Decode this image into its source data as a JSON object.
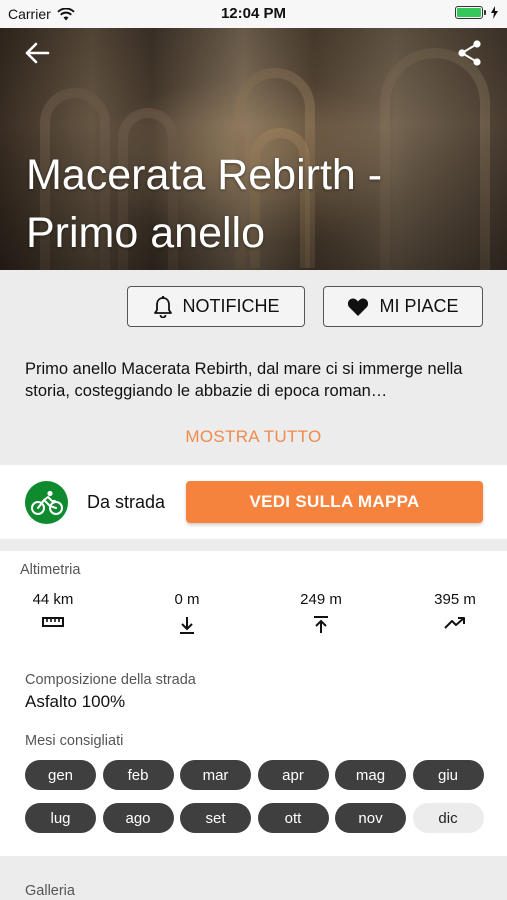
{
  "status_bar": {
    "carrier": "Carrier",
    "time": "12:04 PM",
    "battery_level": 1.0,
    "battery_color": "#35c759"
  },
  "hero": {
    "title": "Macerata Rebirth - Primo anello",
    "back_icon": "back-arrow-icon",
    "share_icon": "share-icon"
  },
  "actions": {
    "notify_label": "NOTIFICHE",
    "like_label": "MI PIACE"
  },
  "description": {
    "text": "Primo anello Macerata Rebirth, dal mare ci si immerge nella storia, costeggiando le abbazie di epoca roman…",
    "show_all": "MOSTRA TUTTO"
  },
  "route": {
    "type_icon": "road-bike-icon",
    "type_label": "Da strada",
    "map_button": "VEDI SULLA MAPPA",
    "accent_color": "#f5833d",
    "type_color": "#0f8a2e"
  },
  "altimetry": {
    "label": "Altimetria",
    "distance": "44 km",
    "min_altitude": "0 m",
    "max_altitude": "249 m",
    "elevation_gain": "395 m"
  },
  "road": {
    "label": "Composizione della strada",
    "value": "Asfalto 100%"
  },
  "months": {
    "label": "Mesi consigliati",
    "items": [
      {
        "label": "gen",
        "recommended": true
      },
      {
        "label": "feb",
        "recommended": true
      },
      {
        "label": "mar",
        "recommended": true
      },
      {
        "label": "apr",
        "recommended": true
      },
      {
        "label": "mag",
        "recommended": true
      },
      {
        "label": "giu",
        "recommended": true
      },
      {
        "label": "lug",
        "recommended": true
      },
      {
        "label": "ago",
        "recommended": true
      },
      {
        "label": "set",
        "recommended": true
      },
      {
        "label": "ott",
        "recommended": true
      },
      {
        "label": "nov",
        "recommended": true
      },
      {
        "label": "dic",
        "recommended": false
      }
    ]
  },
  "gallery": {
    "label": "Galleria"
  }
}
